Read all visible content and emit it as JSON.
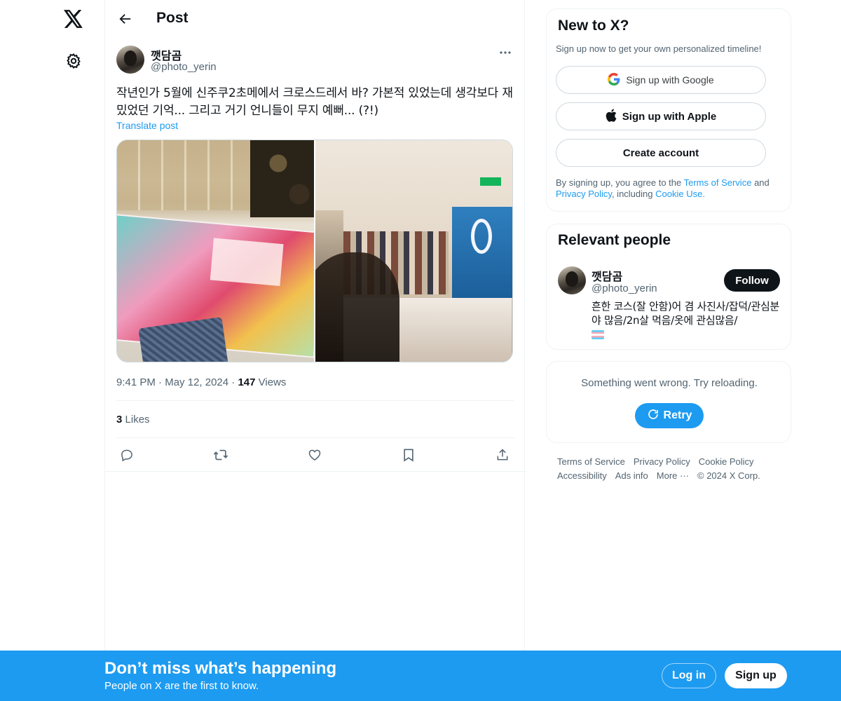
{
  "header": {
    "title": "Post"
  },
  "post": {
    "author_name": "깻담곰",
    "author_handle": "@photo_yerin",
    "text": "작년인가 5월에 신주쿠2초메에서 크로스드레서 바? 가본적 있었는데 생각보다 재밌었던 기억... 그리고 거기 언니들이 무지 예뻐... (?!)",
    "translate_label": "Translate post",
    "time": "9:41 PM",
    "date": "May 12, 2024",
    "views_count": "147",
    "views_label": "Views",
    "likes_count": "3",
    "likes_label": "Likes"
  },
  "signup_card": {
    "title": "New to X?",
    "subtitle": "Sign up now to get your own personalized timeline!",
    "google_label": "Sign up with Google",
    "apple_label": "Sign up with Apple",
    "create_label": "Create account",
    "legal_prefix": "By signing up, you agree to the",
    "terms_link": "Terms of Service",
    "and": "and",
    "privacy_link": "Privacy Policy",
    "including": ", including",
    "cookie_link": "Cookie Use",
    "period": "."
  },
  "relevant": {
    "title": "Relevant people",
    "name": "깻담곰",
    "handle": "@photo_yerin",
    "follow_label": "Follow",
    "bio": "흔한 코스(잘 안함)어 겸 사진사/잡덕/관심분야 많음/2n살 먹음/옷에 관심많음/"
  },
  "error_card": {
    "message": "Something went wrong. Try reloading.",
    "retry_label": "Retry"
  },
  "footer": {
    "links": [
      "Terms of Service",
      "Privacy Policy",
      "Cookie Policy",
      "Accessibility",
      "Ads info",
      "More ···",
      "© 2024 X Corp."
    ]
  },
  "banner": {
    "title": "Don’t miss what’s happening",
    "subtitle": "People on X are the first to know.",
    "login_label": "Log in",
    "signup_label": "Sign up"
  },
  "colors": {
    "accent": "#1d9bf0",
    "text": "#0f1419",
    "muted": "#536471",
    "border": "#eff3f4"
  },
  "icons": [
    "x-logo-icon",
    "gear-icon",
    "back-arrow-icon",
    "more-icon",
    "reply-icon",
    "repost-icon",
    "like-icon",
    "bookmark-icon",
    "share-icon",
    "google-icon",
    "apple-icon",
    "refresh-icon",
    "trans-flag-icon"
  ]
}
